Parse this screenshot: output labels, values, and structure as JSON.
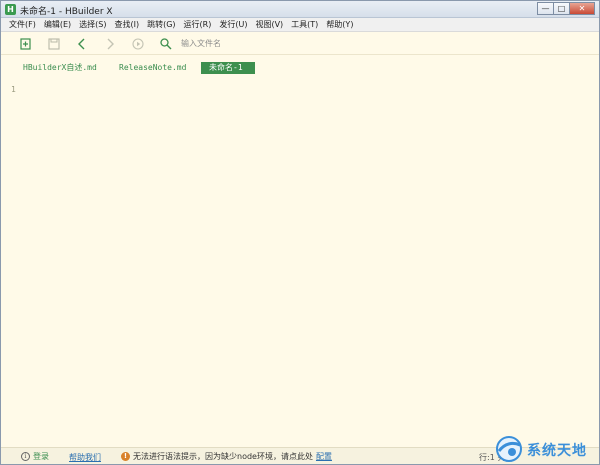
{
  "window": {
    "title": "未命名-1 - HBuilder X",
    "app_icon": "H"
  },
  "window_buttons": {
    "minimize": "—",
    "maximize": "□",
    "close": "✕"
  },
  "menubar": {
    "items": [
      {
        "label": "文件(F)"
      },
      {
        "label": "编辑(E)"
      },
      {
        "label": "选择(S)"
      },
      {
        "label": "查找(I)"
      },
      {
        "label": "跳转(G)"
      },
      {
        "label": "运行(R)"
      },
      {
        "label": "发行(U)"
      },
      {
        "label": "视图(V)"
      },
      {
        "label": "工具(T)"
      },
      {
        "label": "帮助(Y)"
      }
    ]
  },
  "toolbar": {
    "icons": [
      "new-file-icon",
      "save-icon",
      "back-icon",
      "forward-icon",
      "run-icon",
      "search-icon"
    ],
    "search_placeholder": "输入文件名"
  },
  "tabs": [
    {
      "label": "HBuilderX自述.md",
      "active": false
    },
    {
      "label": "ReleaseNote.md",
      "active": false
    },
    {
      "label": "未命名-1",
      "active": true
    }
  ],
  "editor": {
    "line_numbers": [
      "1"
    ]
  },
  "statusbar": {
    "login_label": "登录",
    "help_label": "帮助我们",
    "warning_text": "无法进行语法提示，因为缺少node环境，请点此处",
    "warning_link": "配置",
    "position": "行:1  列:1"
  },
  "watermark": {
    "text": "系统天地"
  },
  "colors": {
    "accent_green": "#3d8f4e",
    "editor_bg": "#fffae8",
    "link_blue": "#2a6fb0",
    "warning_orange": "#d9822b"
  }
}
